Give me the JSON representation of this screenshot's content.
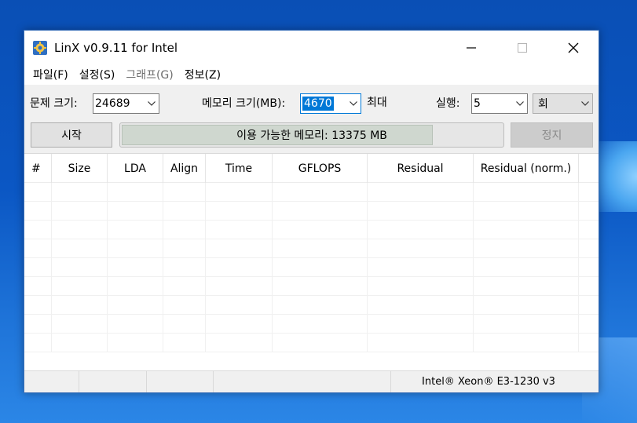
{
  "window": {
    "title": "LinX v0.9.11 for Intel"
  },
  "menu": [
    {
      "label": "파일(F)",
      "enabled": true
    },
    {
      "label": "설정(S)",
      "enabled": true
    },
    {
      "label": "그래프(G)",
      "enabled": false
    },
    {
      "label": "정보(Z)",
      "enabled": true
    }
  ],
  "controls": {
    "problem_size_label": "문제 크기:",
    "problem_size_value": "24689",
    "memory_size_label": "메모리 크기(MB):",
    "memory_size_value": "4670",
    "max_label": "최대",
    "runs_label": "실행:",
    "runs_value": "5",
    "runs_unit": "회",
    "start_label": "시작",
    "stop_label": "정지",
    "available_memory_text": "이용 가능한 메모리: 13375 MB"
  },
  "table": {
    "columns": [
      "#",
      "Size",
      "LDA",
      "Align",
      "Time",
      "GFLOPS",
      "Residual",
      "Residual (norm.)"
    ],
    "rows": []
  },
  "status": {
    "cpu": "Intel® Xeon® E3-1230 v3"
  },
  "colors": {
    "accent": "#0078d7",
    "titlebar": "#ffffff",
    "desktop": "#0b57c4"
  }
}
